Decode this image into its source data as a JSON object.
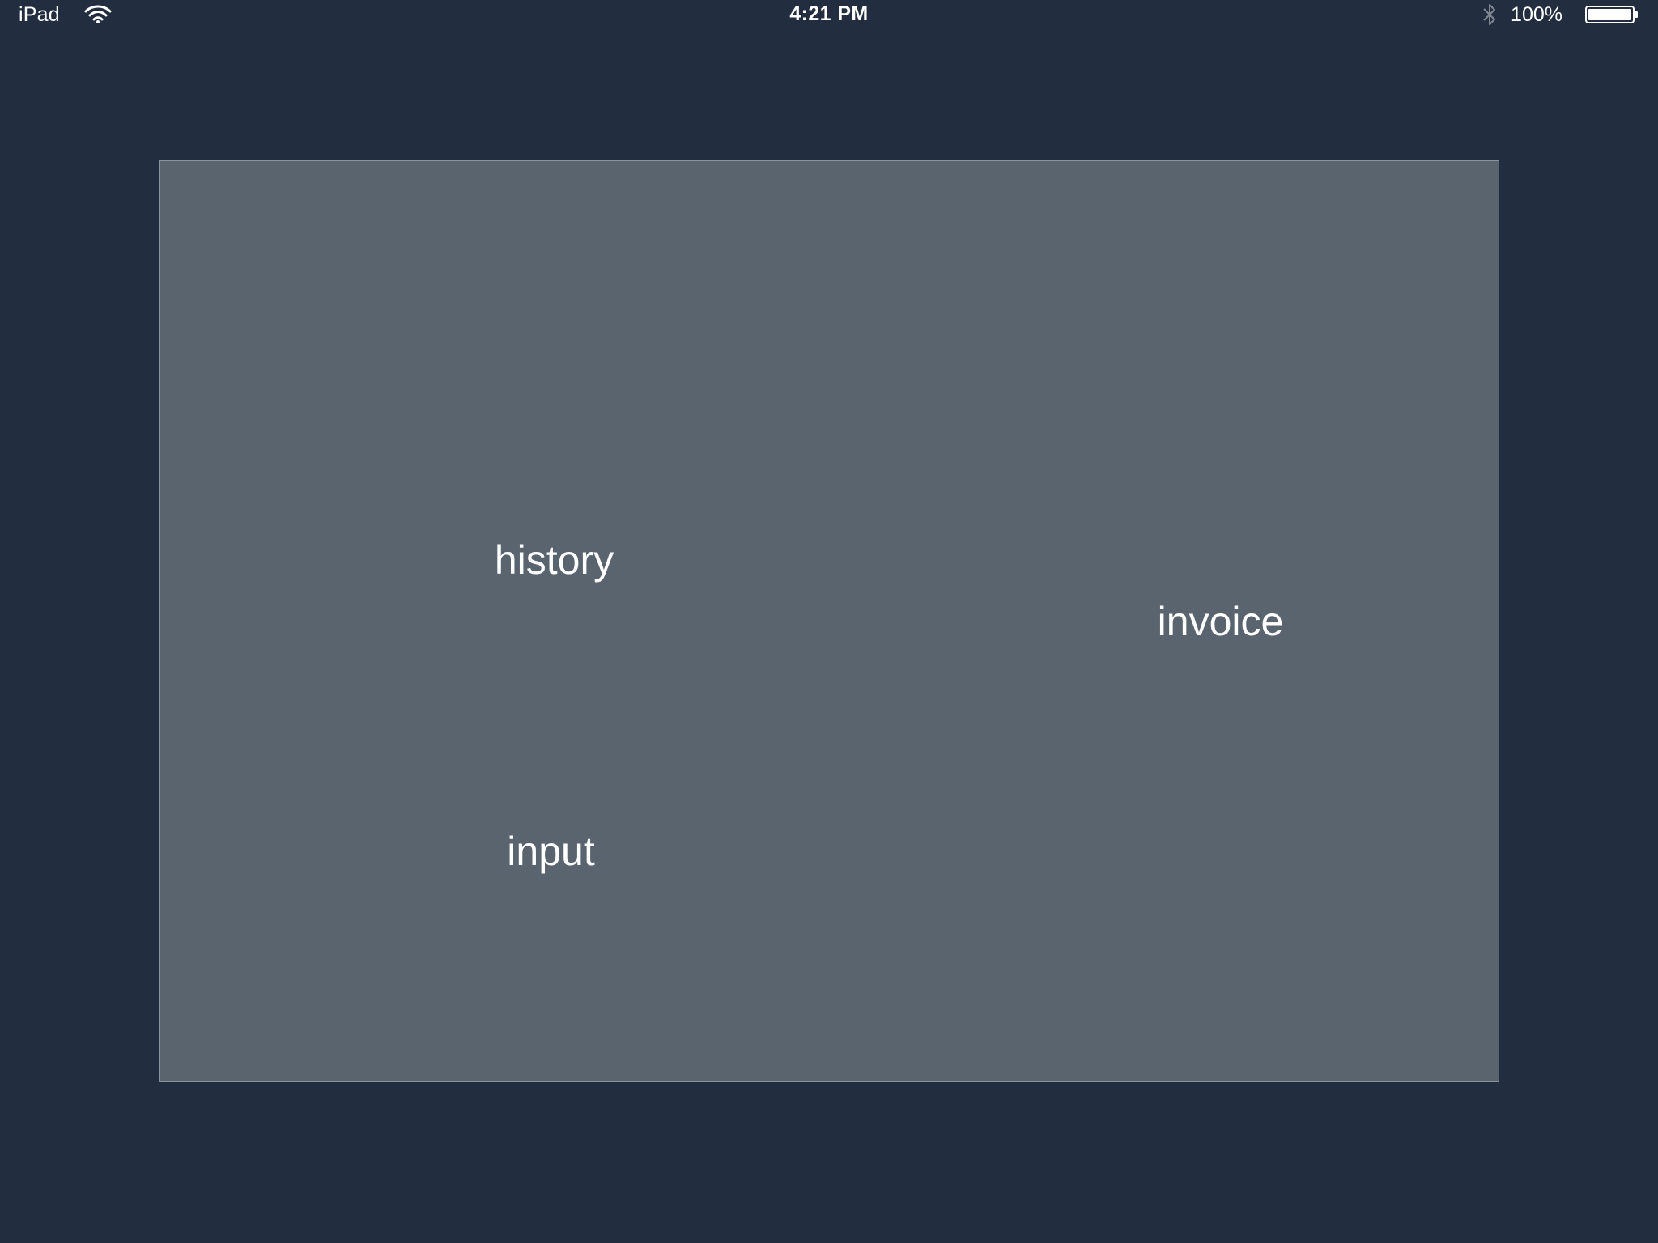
{
  "status_bar": {
    "device": "iPad",
    "time": "4:21 PM",
    "battery_percent": "100%",
    "icons": [
      "wifi-icon",
      "bluetooth-icon",
      "battery-icon"
    ]
  },
  "panels": {
    "history": "history",
    "input": "input",
    "invoice": "invoice"
  },
  "colors": {
    "background": "#222e3f",
    "panel": "#59646f",
    "divider": "#8a939b",
    "text": "#ffffff"
  }
}
